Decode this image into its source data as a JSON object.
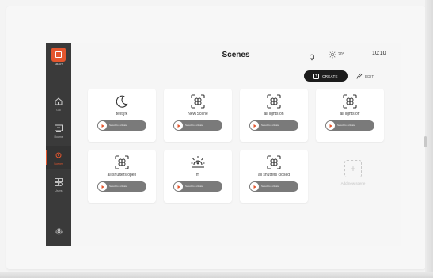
{
  "colors": {
    "accent": "#e4562e",
    "sidebar_bg": "#3a3a3a",
    "pill_bg": "#7a7a7a",
    "create_bg": "#1c1c1c"
  },
  "sidebar": {
    "logo_text": "SMART",
    "items": [
      {
        "icon": "home-icon",
        "label": "Gio"
      },
      {
        "icon": "devices-icon",
        "label": "Rooms"
      },
      {
        "icon": "scenes-icon",
        "label": "Scenes",
        "active": true
      },
      {
        "icon": "users-icon",
        "label": "Users"
      }
    ],
    "settings_icon": "gear-icon"
  },
  "header": {
    "title": "Scenes",
    "notification_icon": "bell-icon",
    "weather_icon": "sun-icon",
    "temperature": "20°",
    "time": "10:10"
  },
  "toolbar": {
    "create_label": "CREATE",
    "edit_label": "EDIT"
  },
  "scenes": [
    {
      "name": "test jfk",
      "icon": "moon-icon",
      "activate_label": "Select to activate"
    },
    {
      "name": "New Scene",
      "icon": "scene-icon",
      "activate_label": "Select to activate"
    },
    {
      "name": "all lights on",
      "icon": "scene-icon",
      "activate_label": "Select to activate"
    },
    {
      "name": "all lights off",
      "icon": "scene-icon",
      "activate_label": "Select to activate"
    },
    {
      "name": "all shutters open",
      "icon": "scene-icon",
      "activate_label": "Select to activate"
    },
    {
      "name": "m",
      "icon": "sunrise-icon",
      "activate_label": "Select to activate"
    },
    {
      "name": "all shutters closed",
      "icon": "scene-icon",
      "activate_label": "Select to activate"
    }
  ],
  "add_scene": {
    "label": "Add new scene",
    "icon": "add-icon"
  }
}
